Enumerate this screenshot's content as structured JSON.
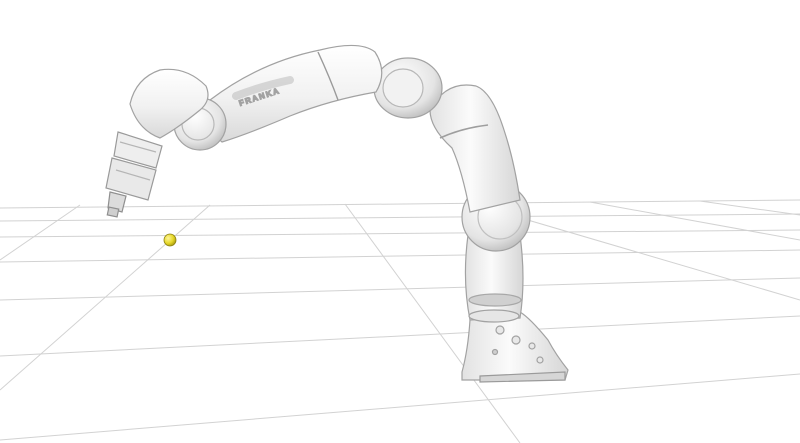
{
  "scene": {
    "background_color": "#ffffff",
    "grid_color": "#cfcfcf",
    "robot": {
      "brand_label": "FRANKA",
      "body_color": "#f4f4f4",
      "outline_color": "#9a9a9a",
      "shade_color": "#bdbdbd"
    },
    "target": {
      "color": "#e6d82a",
      "outline_color": "#8a7f10"
    }
  }
}
